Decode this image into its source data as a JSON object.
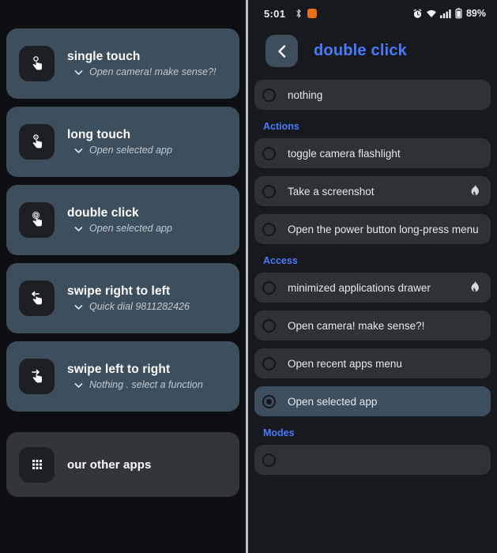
{
  "left_panel": {
    "gestures": [
      {
        "icon": "single-touch-icon",
        "title": "single touch",
        "action": "Open camera! make sense?!"
      },
      {
        "icon": "long-touch-icon",
        "title": "long touch",
        "action": "Open selected app"
      },
      {
        "icon": "double-click-icon",
        "title": "double click",
        "action": "Open selected app"
      },
      {
        "icon": "swipe-left-icon",
        "title": "swipe right to left",
        "action": "Quick dial 9811282426"
      },
      {
        "icon": "swipe-right-icon",
        "title": "swipe left to right",
        "action": "Nothing . select a function"
      }
    ],
    "other_apps": {
      "icon": "apps-grid-icon",
      "title": "our other apps"
    }
  },
  "right_panel": {
    "statusbar": {
      "time": "5:01",
      "left_icons": [
        "bluetooth-icon",
        "orange-app-icon"
      ],
      "right_icons": [
        "alarm-icon",
        "wifi-icon",
        "signal-icon",
        "battery-icon"
      ],
      "battery_text": "89%"
    },
    "header": {
      "back_icon": "chevron-left-icon",
      "title": "double click",
      "title_color": "#4a7afc"
    },
    "sections": [
      {
        "label": null,
        "options": [
          {
            "label": "nothing",
            "selected": false,
            "badge": null
          }
        ]
      },
      {
        "label": "Actions",
        "options": [
          {
            "label": "toggle camera flashlight",
            "selected": false,
            "badge": null
          },
          {
            "label": "Take a screenshot",
            "selected": false,
            "badge": "flame-icon"
          },
          {
            "label": "Open the power button long-press menu",
            "selected": false,
            "badge": null
          }
        ]
      },
      {
        "label": "Access",
        "options": [
          {
            "label": "minimized applications drawer",
            "selected": false,
            "badge": "flame-icon"
          },
          {
            "label": "Open camera! make sense?!",
            "selected": false,
            "badge": null
          },
          {
            "label": "Open recent apps menu",
            "selected": false,
            "badge": null
          },
          {
            "label": "Open selected app",
            "selected": true,
            "badge": null
          }
        ]
      },
      {
        "label": "Modes",
        "options": []
      }
    ]
  },
  "colors": {
    "accent_blue": "#4a7afc",
    "card_slate": "#3d4f5c",
    "card_gray": "#2e3135",
    "background": "#16191d",
    "orange_badge": "#e8701a"
  }
}
